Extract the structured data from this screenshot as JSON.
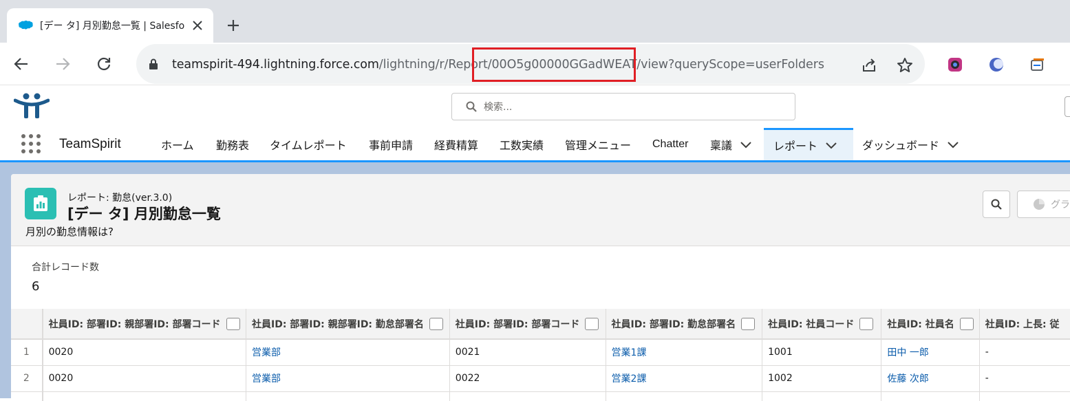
{
  "browser": {
    "tab_title": "[デー タ] 月別勤怠一覧 | Salesfo",
    "url_host": "teamspirit-494.lightning.force.com",
    "url_path": "/lightning/r/Report/00O5g00000GGadWEAT/view?queryScope=userFolders"
  },
  "header": {
    "search_placeholder": "検索..."
  },
  "nav": {
    "app_name": "TeamSpirit",
    "items": [
      {
        "label": "ホーム"
      },
      {
        "label": "勤務表"
      },
      {
        "label": "タイムレポート"
      },
      {
        "label": "事前申請"
      },
      {
        "label": "経費精算"
      },
      {
        "label": "工数実績"
      },
      {
        "label": "管理メニュー"
      },
      {
        "label": "Chatter"
      },
      {
        "label": "稟議"
      },
      {
        "label": "レポート"
      },
      {
        "label": "ダッシュボード"
      }
    ]
  },
  "report": {
    "subtitle": "レポート: 勤怠(ver.3.0)",
    "title": "[デー タ] 月別勤怠一覧",
    "description": "月別の勤怠情報は?",
    "chart_button_label": "グラ",
    "record_count_label": "合計レコード数",
    "record_count": "6",
    "columns": [
      "社員ID: 部署ID: 親部署ID: 部署コード",
      "社員ID: 部署ID: 親部署ID: 勤怠部署名",
      "社員ID: 部署ID: 部署コード",
      "社員ID: 部署ID: 勤怠部署名",
      "社員ID: 社員コード",
      "社員ID: 社員名",
      "社員ID: 上長: 従"
    ],
    "rows": [
      {
        "num": "1",
        "cells": [
          "0020",
          "営業部",
          "0021",
          "営業1課",
          "1001",
          "田中 一郎",
          "-"
        ]
      },
      {
        "num": "2",
        "cells": [
          "0020",
          "営業部",
          "0022",
          "営業2課",
          "1002",
          "佐藤 次郎",
          "-"
        ]
      }
    ]
  }
}
